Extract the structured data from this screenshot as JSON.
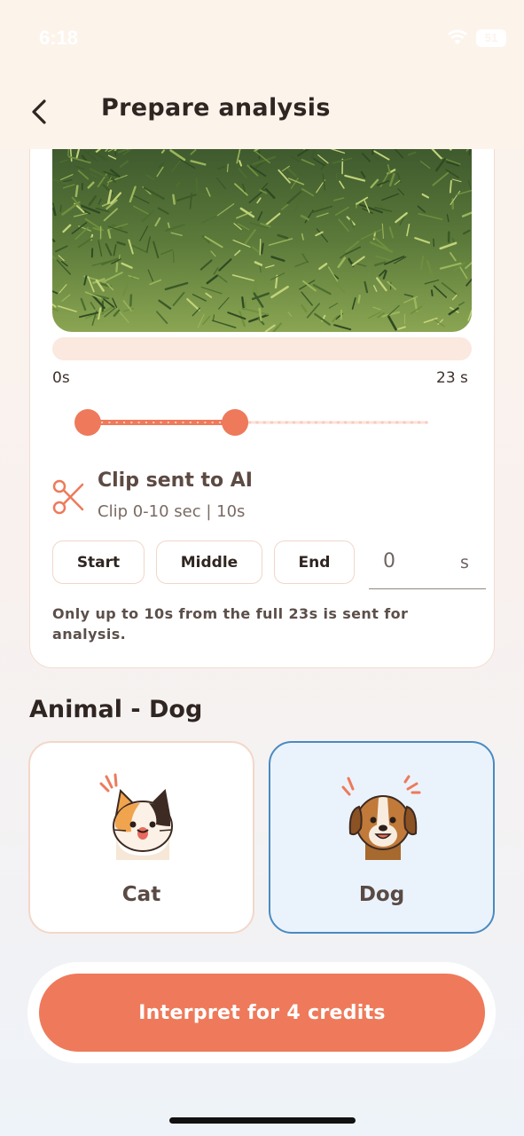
{
  "status_bar": {
    "time": "6:18",
    "battery": "51"
  },
  "nav": {
    "title": "Prepare analysis"
  },
  "video": {
    "start_label": "0s",
    "end_label": "23 s",
    "duration_seconds": 23,
    "clip_start_seconds": 0,
    "clip_end_seconds": 10
  },
  "clip": {
    "title": "Clip sent to AI",
    "subtitle": "Clip 0-10 sec | 10s"
  },
  "position_buttons": [
    "Start",
    "Middle",
    "End"
  ],
  "offset": {
    "value": "0",
    "unit": "s"
  },
  "info": "Only up to 10s from the full 23s is sent for analysis.",
  "animal_section": {
    "title": "Animal - Dog",
    "options": [
      {
        "label": "Cat",
        "selected": false
      },
      {
        "label": "Dog",
        "selected": true
      }
    ]
  },
  "cta": {
    "label": "Interpret for 4 credits"
  },
  "colors": {
    "accent": "#ee7a5b",
    "selected": "#4a8ac0",
    "cardBorder": "#f3d7c9"
  }
}
